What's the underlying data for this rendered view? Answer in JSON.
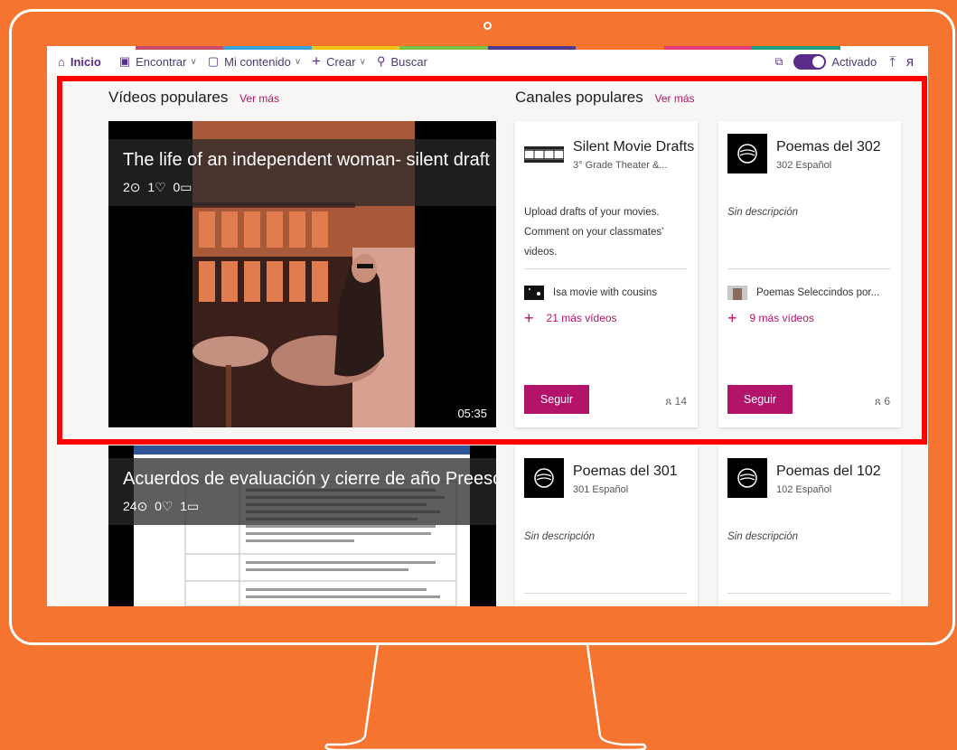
{
  "topbar": {
    "home": "Inicio",
    "find": "Encontrar",
    "my_content": "Mi contenido",
    "create": "Crear",
    "search": "Buscar",
    "toggle_label": "Activado"
  },
  "popular_videos": {
    "title": "Vídeos populares",
    "see_more": "Ver más",
    "items": [
      {
        "title": "The life of an independent woman- silent draft ...",
        "views": "2",
        "likes": "1",
        "comments": "0",
        "duration": "05:35"
      },
      {
        "title": "Acuerdos de evaluación y cierre de año Preesco...",
        "views": "24",
        "likes": "0",
        "comments": "1"
      }
    ]
  },
  "popular_channels": {
    "title": "Canales populares",
    "see_more": "Ver más",
    "items": [
      {
        "name": "Silent Movie Drafts",
        "subtitle": "3° Grade Theater &...",
        "description": "Upload drafts of your movies. Comment on your classmates' videos.",
        "video_title": "Isa movie with cousins",
        "more_videos": "21 más vídeos",
        "follow": "Seguir",
        "followers": "14"
      },
      {
        "name": "Poemas del 302",
        "subtitle": "302 Español",
        "description": "Sin descripción",
        "video_title": "Poemas Seleccindos por...",
        "more_videos": "9 más vídeos",
        "follow": "Seguir",
        "followers": "6"
      },
      {
        "name": "Poemas del 301",
        "subtitle": "301 Español",
        "description": "Sin descripción"
      },
      {
        "name": "Poemas del 102",
        "subtitle": "102 Español",
        "description": "Sin descripción"
      }
    ]
  },
  "colors": {
    "background": "#F47430",
    "accent": "#B4136A",
    "brand": "#5B2B8A",
    "highlight": "#FF0000"
  }
}
